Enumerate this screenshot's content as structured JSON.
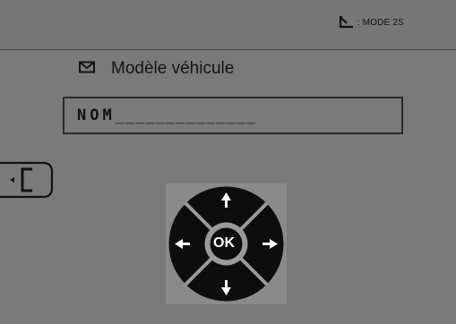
{
  "header": {
    "mode_icon": "return-arrow-icon",
    "mode_text": ": MODE 2S"
  },
  "screen": {
    "title_icon": "envelope-icon",
    "title": "Modèle véhicule"
  },
  "name_field": {
    "value": "NOM",
    "placeholder": "______________"
  },
  "back": {
    "icon": "back-bracket-icon"
  },
  "dpad": {
    "ok_label": "OK",
    "up_icon": "arrow-up-icon",
    "down_icon": "arrow-down-icon",
    "left_icon": "arrow-left-icon",
    "right_icon": "arrow-right-icon"
  },
  "colors": {
    "background": "#7a7a7a",
    "dark": "#111111",
    "dpad_fill": "#0d0d0d",
    "dpad_ring": "#9a9a9a"
  }
}
